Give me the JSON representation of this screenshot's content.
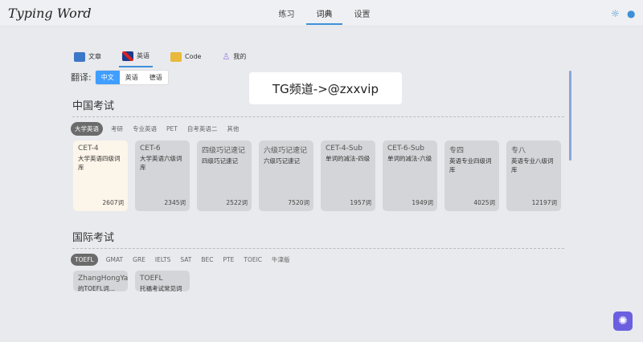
{
  "app": {
    "title": "Typing Word"
  },
  "nav": [
    {
      "label": "练习"
    },
    {
      "label": "词典",
      "active": true
    },
    {
      "label": "设置"
    }
  ],
  "header_icons": [
    "sun-icon",
    "github-icon"
  ],
  "dict_tabs": [
    {
      "label": "文章",
      "icon": "book-icon"
    },
    {
      "label": "英语",
      "icon": "uk-flag-icon",
      "active": true
    },
    {
      "label": "Code",
      "icon": "coder-icon"
    },
    {
      "label": "我的",
      "icon": "user-icon"
    }
  ],
  "translate": {
    "label": "翻译:",
    "options": [
      "中文",
      "英语",
      "德语"
    ],
    "selected": "中文"
  },
  "banner": "TG频道->@zxxvip",
  "sections": [
    {
      "title": "中国考试",
      "categories": [
        "大学英语",
        "考研",
        "专业英语",
        "PET",
        "自考英语二",
        "其他"
      ],
      "active_category": "大学英语",
      "cards": [
        {
          "name": "CET-4",
          "desc": "大学英语四级词库",
          "count": "2607词",
          "selected": true
        },
        {
          "name": "CET-6",
          "desc": "大学英语六级词库",
          "count": "2345词"
        },
        {
          "name": "四级巧记速记",
          "desc": "四级巧记速记",
          "count": "2522词"
        },
        {
          "name": "六级巧记速记",
          "desc": "六级巧记速记",
          "count": "7520词"
        },
        {
          "name": "CET-4-Sub",
          "desc": "单词的减法-四级",
          "count": "1957词"
        },
        {
          "name": "CET-6-Sub",
          "desc": "单词的减法-六级",
          "count": "1949词"
        },
        {
          "name": "专四",
          "desc": "英语专业四级词库",
          "count": "4025词"
        },
        {
          "name": "专八",
          "desc": "英语专业八级词库",
          "count": "12197词"
        }
      ]
    },
    {
      "title": "国际考试",
      "categories": [
        "TOEFL",
        "GMAT",
        "GRE",
        "IELTS",
        "SAT",
        "BEC",
        "PTE",
        "TOEIC",
        "牛津版"
      ],
      "active_category": "TOEFL",
      "cards": [
        {
          "name": "ZhangHongYa",
          "desc": "的TOEFL词..."
        },
        {
          "name": "TOEFL",
          "desc": "托福考试常见词"
        }
      ]
    }
  ],
  "colors": {
    "accent": "#409eff",
    "selected_card": "#fcf5e9",
    "fab": "#6b5fe0"
  }
}
